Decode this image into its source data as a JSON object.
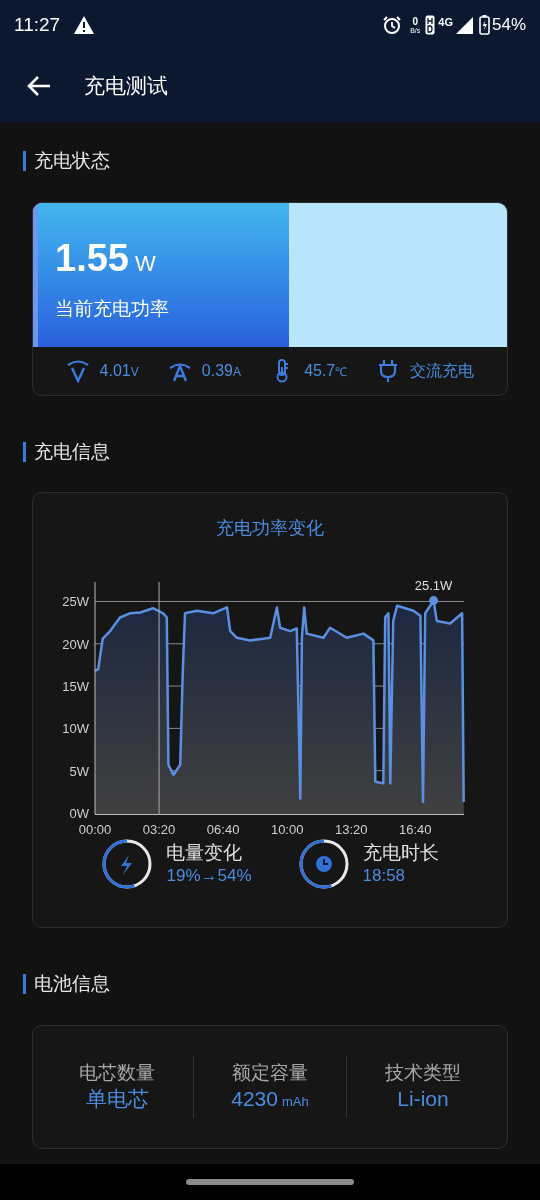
{
  "status_bar": {
    "time": "11:27",
    "net_speed_value": "0",
    "net_speed_unit": "B/s",
    "network": "4G",
    "battery": "54%"
  },
  "header": {
    "title": "充电测试"
  },
  "sections": [
    {
      "title": "充电状态"
    },
    {
      "title": "充电信息"
    },
    {
      "title": "电池信息"
    }
  ],
  "power_card": {
    "value": "1.55",
    "unit": "W",
    "label": "当前充电功率",
    "level": 0.54,
    "stats": [
      {
        "kind": "voltage",
        "value": "4.01",
        "unit": "V"
      },
      {
        "kind": "current",
        "value": "0.39",
        "unit": "A"
      },
      {
        "kind": "temperature",
        "value": "45.7",
        "unit": "℃"
      },
      {
        "kind": "plug",
        "value": "交流充电"
      }
    ]
  },
  "info_card": {
    "title": "充电功率变化",
    "chart_data": {
      "type": "area",
      "x": [
        0,
        10,
        24,
        47,
        78,
        109,
        141,
        181,
        213,
        224,
        229,
        245,
        266,
        274,
        281,
        318,
        369,
        412,
        422,
        443,
        484,
        525,
        547,
        568,
        578,
        609,
        630,
        641,
        646,
        653,
        661,
        713,
        734,
        786,
        838,
        869,
        875,
        900,
        906,
        916,
        922,
        931,
        943,
        994,
        1016,
        1024,
        1031,
        1057,
        1067,
        1109,
        1146,
        1151
      ],
      "series": [
        {
          "color": "#5b8fe0",
          "values": [
            16.8,
            17.0,
            20.6,
            21.5,
            23.1,
            23.6,
            23.7,
            24.2,
            23.6,
            23.1,
            5.7,
            4.5,
            5.7,
            16.8,
            23.6,
            23.9,
            23.6,
            24.3,
            21.5,
            20.7,
            20.4,
            20.6,
            20.7,
            24.3,
            21.9,
            21.5,
            21.8,
            1.7,
            20.7,
            24.3,
            21.2,
            20.7,
            21.9,
            20.7,
            21.2,
            20.4,
            3.7,
            3.5,
            23.1,
            23.6,
            3.5,
            22.7,
            24.5,
            23.9,
            23.3,
            1.3,
            23.6,
            25.1,
            22.7,
            22.4,
            23.6,
            1.3
          ]
        }
      ],
      "xlim": [
        0,
        1152
      ],
      "ylim": [
        0,
        27.3
      ],
      "grid": true,
      "ref_lines": [
        {
          "axis": "x",
          "value": 200
        }
      ],
      "xticks": [
        {
          "value": 0,
          "label": "00:00"
        },
        {
          "value": 200,
          "label": "03:20"
        },
        {
          "value": 400,
          "label": "06:40"
        },
        {
          "value": 600,
          "label": "10:00"
        },
        {
          "value": 800,
          "label": "13:20"
        },
        {
          "value": 1000,
          "label": "16:40"
        }
      ],
      "yticks": [
        {
          "value": 0,
          "label": "0W"
        },
        {
          "value": 5,
          "label": "5W"
        },
        {
          "value": 10,
          "label": "10W"
        },
        {
          "value": 15,
          "label": "15W"
        },
        {
          "value": 20,
          "label": "20W"
        },
        {
          "value": 25,
          "label": "25W"
        }
      ],
      "annotations": [
        {
          "x": 1057,
          "y": 25.1,
          "text": "25.1W"
        }
      ]
    },
    "summaries": [
      {
        "kind": "battery",
        "label": "电量变化",
        "value": "19%→54%"
      },
      {
        "kind": "time",
        "label": "充电时长",
        "value": "18:58"
      }
    ]
  },
  "battery_card": {
    "items": [
      {
        "label": "电芯数量",
        "value": "单电芯"
      },
      {
        "label": "额定容量",
        "value": "4230",
        "unit": "mAh"
      },
      {
        "label": "技术类型",
        "value": "Li-ion"
      }
    ]
  }
}
